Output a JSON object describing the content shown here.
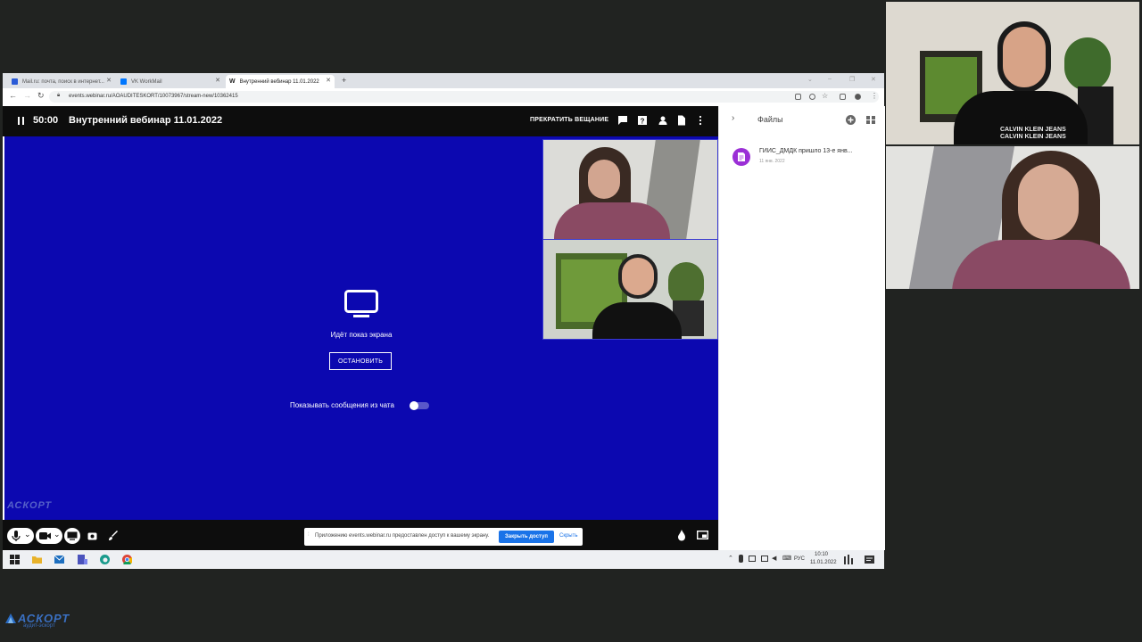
{
  "browser": {
    "tabs": [
      {
        "label": "Mail.ru: почта, поиск в интернет...",
        "favicon_color": "#2a5bd7"
      },
      {
        "label": "VK WorkMail",
        "favicon_color": "#0077ff"
      },
      {
        "label": "Внутренний вебинар 11.01.2022",
        "favicon_color": "#222222"
      }
    ],
    "url": "events.webinar.ru/AOAUDITESKORT/10073967/stream-new/10362415"
  },
  "webinar": {
    "timer": "50:00",
    "title": "Внутренний вебинар 11.01.2022",
    "stop_broadcast": "ПРЕКРАТИТЬ ВЕЩАНИЕ",
    "sharing_label": "Идёт показ экрана",
    "stop_button": "ОСТАНОВИТЬ",
    "chat_toggle_label": "Показывать сообщения из чата",
    "chat_toggle_on": false,
    "stage_color": "#0c08b0"
  },
  "notification": {
    "text": "Приложению events.webinar.ru предоставлен доступ к вашему экрану.",
    "grant_button": "Закрыть доступ",
    "hide_link": "Скрыть"
  },
  "files_panel": {
    "title": "Файлы",
    "files": [
      {
        "name": "ГИИС_ДМДК пришло 13-е янв...",
        "date": "11 янв. 2022",
        "icon_color": "#9b2fd6"
      }
    ]
  },
  "taskbar": {
    "language": "РУС",
    "time": "10:10",
    "date": "11.01.2022"
  },
  "branding": {
    "logo": "АСКОРТ",
    "logo_sub": "аудит-эскорт"
  },
  "icons": [
    "pause-icon",
    "chat-icon",
    "question-icon",
    "participants-icon",
    "document-icon",
    "more-icon",
    "monitor-icon",
    "mic-icon",
    "camera-icon",
    "screen-share-icon",
    "record-icon",
    "brush-icon",
    "fire-icon",
    "pip-icon",
    "chevron-right-icon",
    "add-icon",
    "grid-icon",
    "file-icon",
    "windows-start-icon",
    "explorer-icon",
    "mail-app-icon",
    "teams-icon",
    "edge-icon",
    "chrome-icon"
  ]
}
